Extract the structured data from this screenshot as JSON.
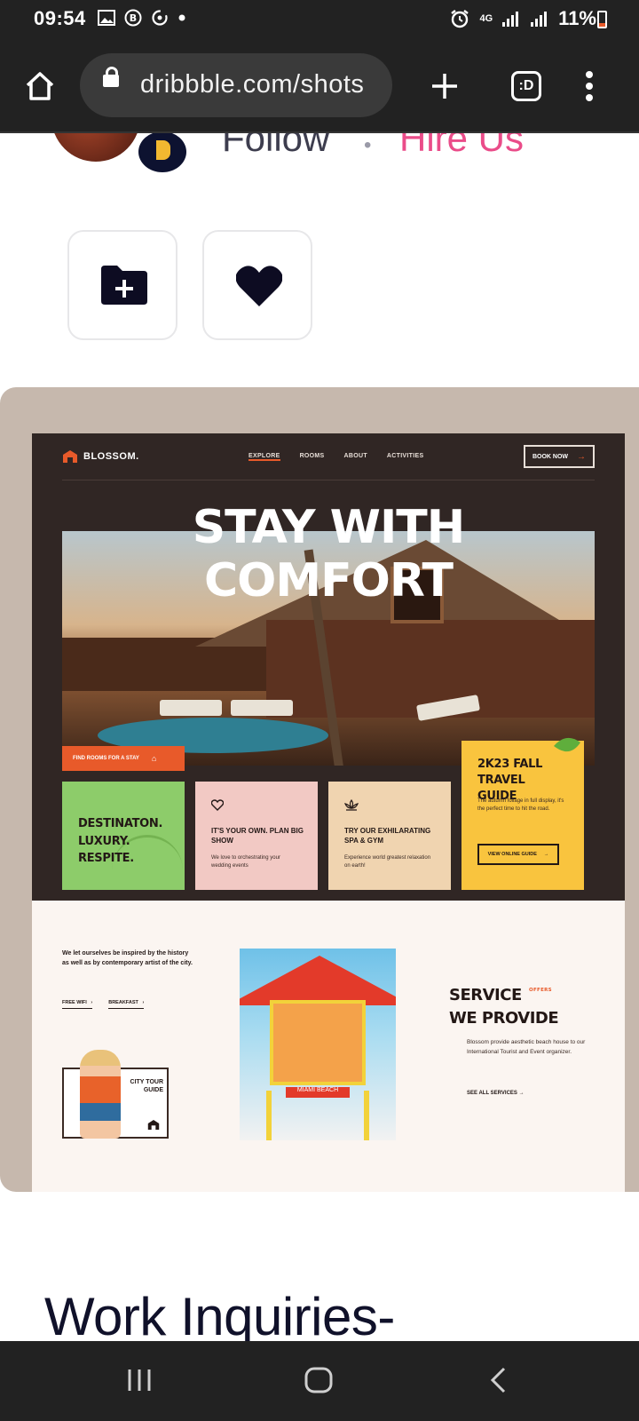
{
  "status_bar": {
    "time": "09:54",
    "network": "4G",
    "battery": "11%",
    "battery_level": 0.11
  },
  "browser": {
    "url": "dribbble.com/shots",
    "tab_count_icon": ":D"
  },
  "profile": {
    "follow_label": "Follow",
    "separator": "•",
    "hire_label": "Hire Us",
    "hire_color": "#ea4c89"
  },
  "site": {
    "logo": "BLOSSOM.",
    "nav": [
      "EXPLORE",
      "ROOMS",
      "ABOUT",
      "ACTIVITIES"
    ],
    "book_now": "BOOK NOW",
    "hero_title": "STAY WITH COMFORT",
    "find_rooms": "FIND ROOMS FOR A STAY",
    "tiles": {
      "green": "DESTINATON. LUXURY. RESPITE.",
      "pink_title": "IT'S YOUR OWN. PLAN BIG SHOW",
      "pink_text": "We love to orchestrating your wedding events",
      "beige_title": "TRY OUR EXHILARATING SPA & GYM",
      "beige_text": "Experience world greatest relaxation on earth!",
      "yellow_title": "2K23 FALL TRAVEL GUIDE",
      "yellow_text": "The autumn foliage in full display, it's the perfect time to hit the road.",
      "yellow_button": "VIEW ONLINE GUIDE"
    },
    "intro": "We let ourselves be inspired by the history as well as by contemporary artist of the city.",
    "links": [
      "FREE WIFI",
      "BREAKFAST"
    ],
    "city_tour": "CITY TOUR GUIDE",
    "tower_sign": "MIAMI BEACH",
    "service_line1": "SERVICE",
    "service_line2": "WE PROVIDE",
    "offers": "OFFERS",
    "service_desc": "Blossom provide aesthetic beach house to our International Tourist and Event organizer.",
    "see_all": "SEE ALL SERVICES",
    "accent": "#e85a2a",
    "bg_dark": "#302624"
  },
  "page": {
    "inquiries_heading": "Work Inquiries-"
  },
  "icons": {
    "home": "home-icon",
    "lock": "lock-icon",
    "new_tab": "plus-icon",
    "tabs": "tab-switcher-icon",
    "menu": "more-vert-icon",
    "save": "folder-plus-icon",
    "like": "heart-icon"
  }
}
